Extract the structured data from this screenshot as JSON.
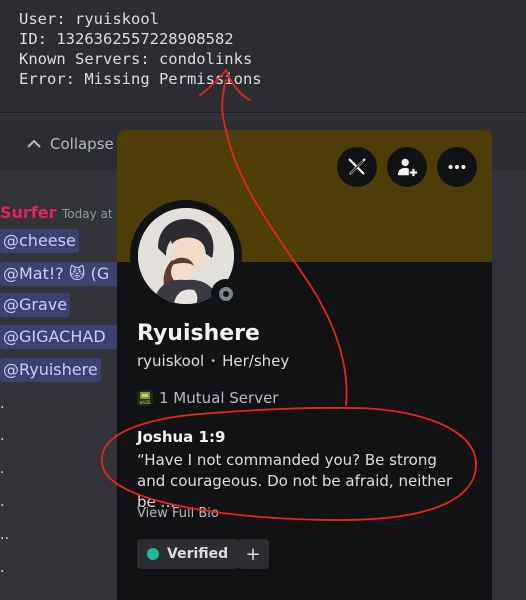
{
  "codeblock": {
    "lines": [
      "User: ryuiskool",
      "ID: 1326362557228908582",
      "Known Servers: condolinks",
      "Error: Missing Permissions"
    ]
  },
  "collapse": {
    "label": "Collapse"
  },
  "message": {
    "sender": "Surfer",
    "timestamp": "Today at",
    "mentions": [
      "@cheese",
      "@Mat!? 😾 (G",
      "@Grave",
      "@GIGACHAD",
      "@Ryuishere"
    ],
    "dots": [
      ".",
      ".",
      ".",
      ".",
      "..",
      "."
    ]
  },
  "profile": {
    "display_name": "Ryuishere",
    "username": "ryuiskool",
    "pronouns": "Her/shey",
    "separator": "•",
    "mutual_servers": "1 Mutual Server",
    "server_icon_text": "HAZE",
    "bio_title": "Joshua 1:9",
    "bio_text": "“Have I not commanded you? Be strong and courageous. Do not be afraid, neither be …",
    "view_full_bio": "View Full Bio",
    "role": "Verified",
    "add_role": "+",
    "banner_color": "#4d3e08",
    "status": "offline"
  },
  "colors": {
    "annotation": "#e8241c",
    "mention_bg": "rgba(88,101,242,0.3)",
    "role_dot": "#1abc9c",
    "sender": "#e0245e"
  }
}
